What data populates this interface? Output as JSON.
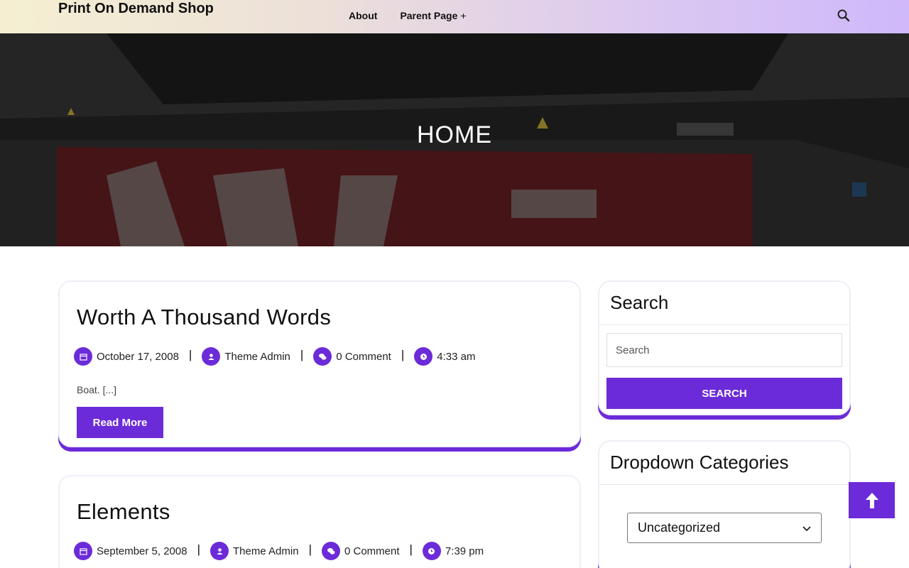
{
  "header": {
    "site_title": "Print On Demand Shop",
    "nav": [
      {
        "label": "About"
      },
      {
        "label": "Parent Page",
        "has_children": true
      }
    ],
    "search_icon": "search-icon"
  },
  "hero": {
    "title": "HOME"
  },
  "posts": [
    {
      "title": "Worth A Thousand Words",
      "date": "October 17, 2008",
      "author": "Theme Admin",
      "comments": "0 Comment",
      "time": "4:33 am",
      "excerpt": "Boat. [...]",
      "read_more": "Read More"
    },
    {
      "title": "Elements",
      "date": "September 5, 2008",
      "author": "Theme Admin",
      "comments": "0 Comment",
      "time": "7:39 pm"
    }
  ],
  "sidebar": {
    "search": {
      "title": "Search",
      "placeholder": "Search",
      "button": "SEARCH"
    },
    "categories": {
      "title": "Dropdown Categories",
      "selected": "Uncategorized"
    }
  },
  "colors": {
    "accent": "#6c2bd9",
    "header_start": "#f5efd2",
    "header_end": "#cfb8fb"
  },
  "icons": [
    "search-icon",
    "calendar-icon",
    "user-icon",
    "comments-icon",
    "clock-icon",
    "arrow-up-icon",
    "chevron-down-icon"
  ]
}
